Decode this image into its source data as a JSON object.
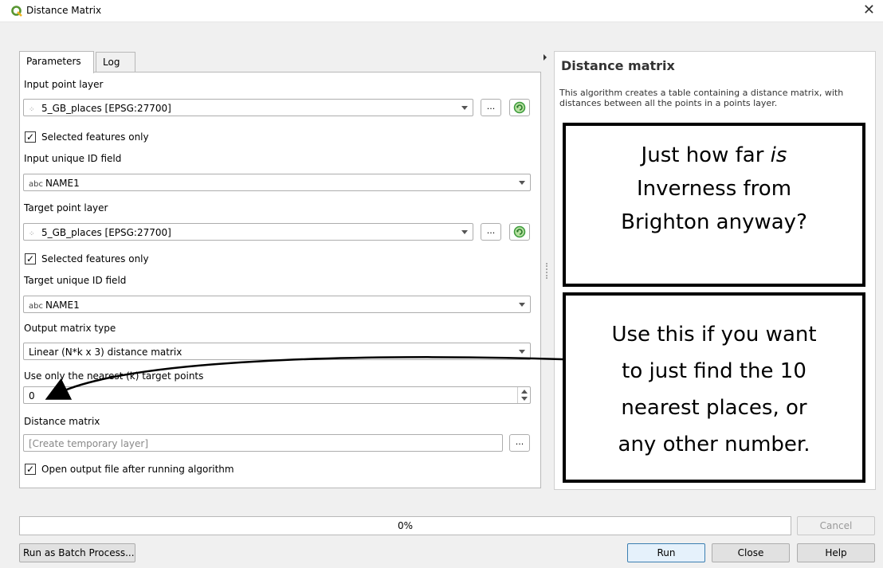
{
  "window": {
    "title": "Distance Matrix",
    "close": "✕"
  },
  "tabs": [
    {
      "label": "Parameters"
    },
    {
      "label": "Log"
    }
  ],
  "form": {
    "input_layer_label": "Input point layer",
    "input_layer_value": "5_GB_places [EPSG:27700]",
    "input_selected_label": "Selected features only",
    "input_id_label": "Input unique ID field",
    "input_id_value": "NAME1",
    "target_layer_label": "Target point layer",
    "target_layer_value": "5_GB_places [EPSG:27700]",
    "target_selected_label": "Selected features only",
    "target_id_label": "Target unique ID field",
    "target_id_value": "NAME1",
    "matrix_type_label": "Output matrix type",
    "matrix_type_value": "Linear (N*k x 3) distance matrix",
    "nearest_label": "Use only the nearest (k) target points",
    "nearest_value": "0",
    "output_label": "Distance matrix",
    "output_placeholder": "[Create temporary layer]",
    "open_output_label": "Open output file after running algorithm",
    "ellipsis": "...",
    "abc": "abc",
    "check": "✓"
  },
  "help": {
    "title": "Distance matrix",
    "description": "This algorithm creates a table containing a distance matrix, with distances between all the points in a points layer."
  },
  "callouts": {
    "first_line1": "Just how far ",
    "first_is": "is",
    "first_line2": "Inverness from",
    "first_line3": "Brighton anyway?",
    "second_lines": [
      "Use this if you want",
      "to just find the 10",
      "nearest places, or",
      "any other number."
    ]
  },
  "bottom": {
    "progress": 0,
    "progress_text": "0%",
    "cancel": "Cancel",
    "batch": "Run as Batch Process...",
    "run": "Run",
    "close": "Close",
    "help": "Help"
  },
  "colors": {
    "qgis_green": "#589632",
    "refresh_green": "#3a9a3a"
  }
}
